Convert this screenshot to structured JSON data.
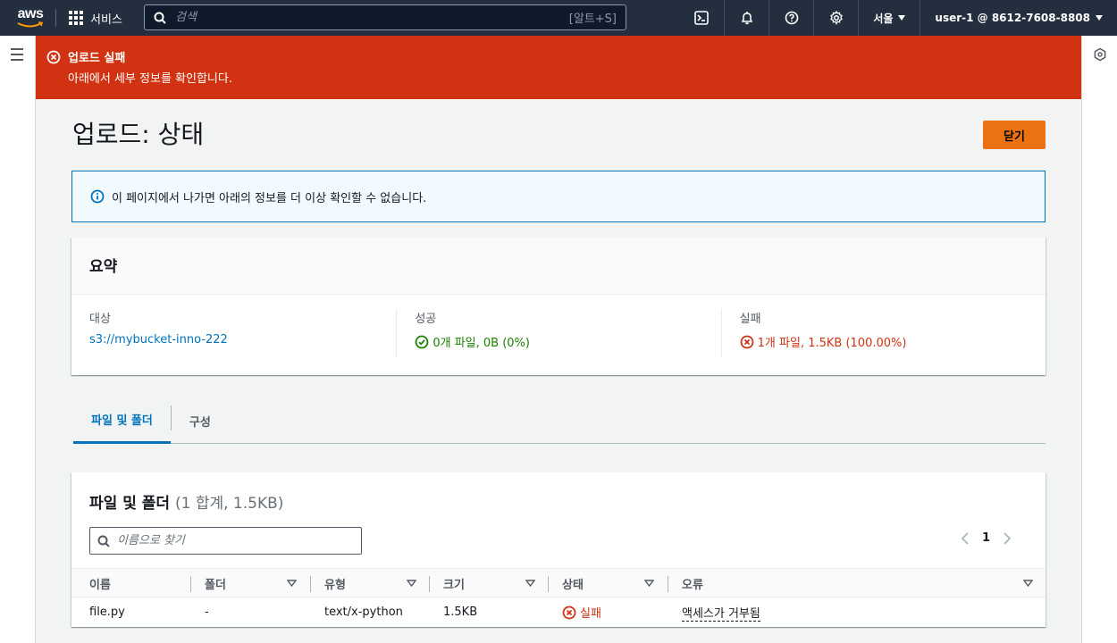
{
  "topnav": {
    "logo": "aws",
    "services_label": "서비스",
    "search_placeholder": "검색",
    "search_shortcut": "[알트+S]",
    "region": "서울",
    "account": "user-1 @ 8612-7608-8808"
  },
  "flash": {
    "title": "업로드 실패",
    "description": "아래에서 세부 정보를 확인합니다."
  },
  "page": {
    "title": "업로드: 상태",
    "close_label": "닫기",
    "info_text": "이 페이지에서 나가면 아래의 정보를 더 이상 확인할 수 없습니다."
  },
  "summary": {
    "heading": "요약",
    "destination_label": "대상",
    "destination_value": "s3://mybucket-inno-222",
    "success_label": "성공",
    "success_value": "0개 파일, 0B (0%)",
    "failed_label": "실패",
    "failed_value": "1개 파일, 1.5KB (100.00%)"
  },
  "tabs": [
    {
      "label": "파일 및 폴더",
      "active": true
    },
    {
      "label": "구성",
      "active": false
    }
  ],
  "files": {
    "title": "파일 및 폴더",
    "count": "(1 합계, 1.5KB)",
    "filter_placeholder": "이름으로 찾기",
    "page": "1",
    "columns": [
      "이름",
      "폴더",
      "유형",
      "크기",
      "상태",
      "오류"
    ],
    "rows": [
      {
        "name": "file.py",
        "folder": "-",
        "type": "text/x-python",
        "size": "1.5KB",
        "status": "실패",
        "error": "액세스가 거부됨"
      }
    ]
  },
  "colors": {
    "nav_bg": "#232f3e",
    "error": "#d13212",
    "accent": "#0073bb",
    "success": "#1d8102",
    "primary_button": "#ec7211"
  }
}
